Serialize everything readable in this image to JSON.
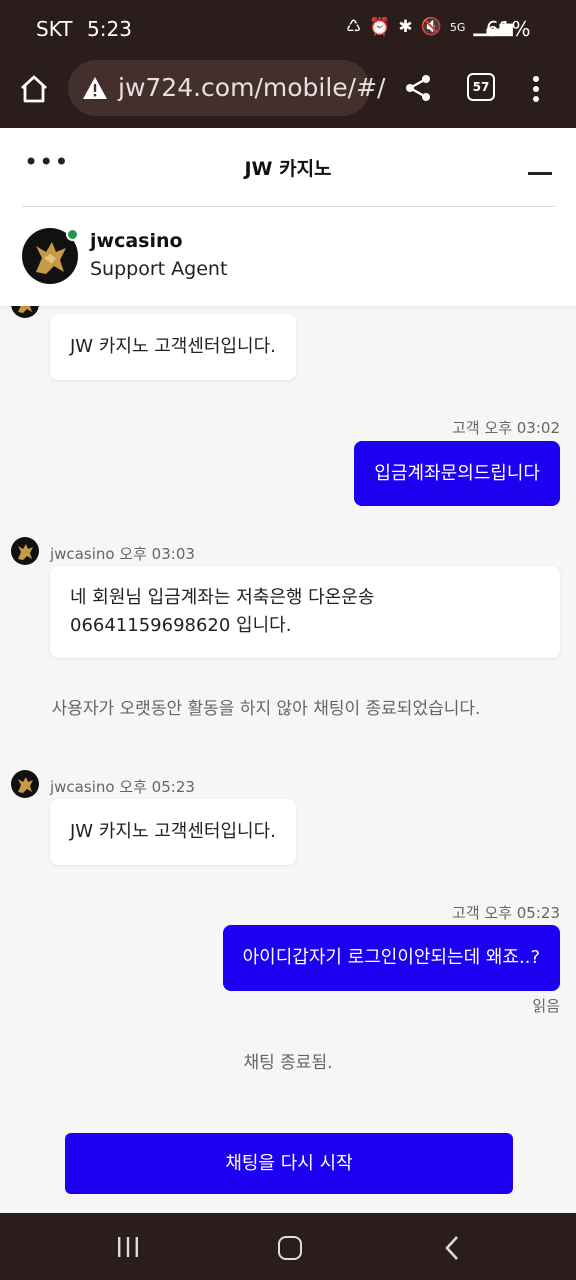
{
  "status_bar": {
    "carrier": "SKT",
    "time": "5:23",
    "battery": "61%"
  },
  "browser": {
    "url": "jw724.com/mobile/#/",
    "tab_count": "57"
  },
  "chat_header": {
    "more": "•••",
    "title": "JW 카지노",
    "agent_name": "jwcasino",
    "agent_role": "Support Agent"
  },
  "messages": {
    "m1_text": "JW 카지노 고객센터입니다.",
    "m2_meta": "고객 오후 03:02",
    "m2_text": "입금계좌문의드립니다",
    "m3_meta": "jwcasino 오후 03:03",
    "m3_line1": "네 회원님 입금계좌는 저축은행 다온운송",
    "m3_line2": "06641159698620 입니다.",
    "system1": "사용자가 오랫동안 활동을 하지 않아 채팅이 종료되었습니다.",
    "m4_meta": "jwcasino 오후 05:23",
    "m4_text": "JW 카지노 고객센터입니다.",
    "m5_meta": "고객 오후 05:23",
    "m5_text": "아이디갑자기 로그인이안되는데 왜죠..?",
    "m5_read": "읽음",
    "system2": "채팅 종료됨."
  },
  "restart_button": "채팅을 다시 시작",
  "colors": {
    "bar_bg": "#2b1d1b",
    "accent": "#1d00f0",
    "online": "#1e9a4e"
  },
  "icons": [
    "home-icon",
    "warning-icon",
    "share-icon",
    "tabs-icon",
    "menu-icon",
    "more-icon",
    "minimize-icon",
    "avatar-dragon-icon",
    "nav-recent-icon",
    "nav-home-icon",
    "nav-back-icon"
  ]
}
